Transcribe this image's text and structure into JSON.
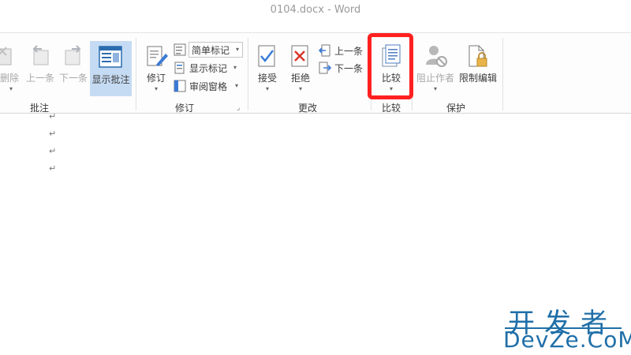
{
  "window": {
    "title": "0104.docx - Word"
  },
  "ribbon": {
    "comments": {
      "label": "批注",
      "delete": "删除",
      "previous": "上一条",
      "next": "下一条",
      "show": "显示批注"
    },
    "tracking": {
      "label": "修订",
      "track_changes": "修订",
      "markup_mode": "简单标记",
      "show_markup": "显示标记",
      "review_pane": "审阅窗格"
    },
    "changes": {
      "label": "更改",
      "accept": "接受",
      "reject": "拒绝",
      "previous": "上一条",
      "next": "下一条"
    },
    "compare": {
      "label": "比较",
      "compare": "比较"
    },
    "protect": {
      "label": "保护",
      "block_authors": "阻止作者",
      "restrict_editing": "限制编辑"
    }
  },
  "document": {
    "paragraph_marks": [
      "↵",
      "↵",
      "↵",
      "↵"
    ]
  },
  "watermark": {
    "cn": "开发者",
    "en": "DevZe.CoM"
  },
  "colors": {
    "highlight": "#ff2020",
    "active_button": "#c5dbf3",
    "watermark": "#1f6fa8"
  }
}
